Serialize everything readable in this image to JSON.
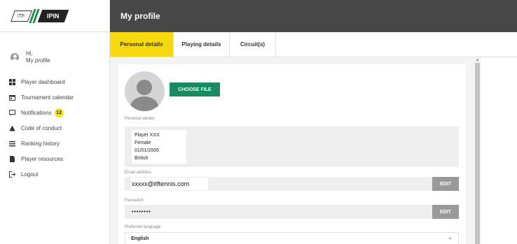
{
  "logo": {
    "left": "ITF",
    "right": "IPIN"
  },
  "sidebar": {
    "greeting": "Hi,",
    "profile_link": "My profile",
    "items": [
      {
        "label": "Player dashboard",
        "icon": "dashboard-icon"
      },
      {
        "label": "Tournament calendar",
        "icon": "calendar-icon"
      },
      {
        "label": "Notifications",
        "icon": "notification-icon",
        "badge": "12"
      },
      {
        "label": "Code of conduct",
        "icon": "warning-icon"
      },
      {
        "label": "Ranking history",
        "icon": "list-icon"
      },
      {
        "label": "Player resources",
        "icon": "document-icon"
      },
      {
        "label": "Logout",
        "icon": "logout-icon"
      }
    ]
  },
  "header": {
    "title": "My profile"
  },
  "tabs": [
    {
      "label": "Personal details",
      "active": true
    },
    {
      "label": "Playing details",
      "active": false
    },
    {
      "label": "Circuit(s)",
      "active": false
    }
  ],
  "profile": {
    "choose_file": "CHOOSE FILE",
    "personal_details_label": "Personal details",
    "personal_details": [
      "Player XXX",
      "Female",
      "01/01/2005",
      "British"
    ],
    "email_label": "Email address",
    "email": "xxxxx@itftennis.com",
    "password_label": "Password",
    "password": "••••••••",
    "edit": "EDIT",
    "language_label": "Preferred language",
    "language": "English"
  },
  "colors": {
    "accent": "#f6d90f",
    "header": "#474747",
    "button_green": "#1a8a60",
    "edit_button": "#9a9a9a",
    "badge": "#f6e21b"
  }
}
